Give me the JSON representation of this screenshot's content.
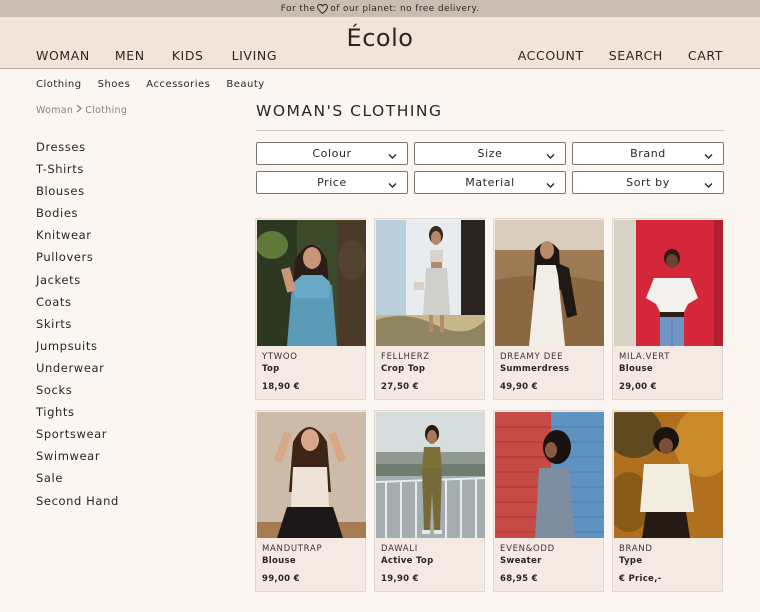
{
  "banner": {
    "prefix": "For the",
    "suffix": "of our planet: no free delivery."
  },
  "header": {
    "logo": "Écolo",
    "nav_left": [
      "WOMAN",
      "MEN",
      "KIDS",
      "LIVING"
    ],
    "nav_right": [
      "ACCOUNT",
      "SEARCH",
      "CART"
    ]
  },
  "subnav": [
    "Clothing",
    "Shoes",
    "Accessories",
    "Beauty"
  ],
  "breadcrumb": [
    "Woman",
    "Clothing"
  ],
  "sidebar": [
    "Dresses",
    "T-Shirts",
    "Blouses",
    "Bodies",
    "Knitwear",
    "Pullovers",
    "Jackets",
    "Coats",
    "Skirts",
    "Jumpsuits",
    "Underwear",
    "Socks",
    "Tights",
    "Sportswear",
    "Swimwear",
    "Sale",
    "Second Hand"
  ],
  "page_title": "WOMAN'S CLOTHING",
  "filters": [
    "Colour",
    "Size",
    "Brand",
    "Price",
    "Material",
    "Sort by"
  ],
  "products": [
    {
      "brand": "YTWOO",
      "type": "Top",
      "price": "18,90 €",
      "photo": "green-garden-blue-top"
    },
    {
      "brand": "FELLHERZ",
      "type": "Crop Top",
      "price": "27,50 €",
      "photo": "sunny-white-wall"
    },
    {
      "brand": "DREAMY DEE",
      "type": "Summerdress",
      "price": "49,90 €",
      "photo": "dry-field-white-dress"
    },
    {
      "brand": "MILA.VERT",
      "type": "Blouse",
      "price": "29,00 €",
      "photo": "red-door"
    },
    {
      "brand": "MANDUTRAP",
      "type": "Blouse",
      "price": "99,00 €",
      "photo": "beige-wall-black-skirt"
    },
    {
      "brand": "DAWALI",
      "type": "Active Top",
      "price": "19,90 €",
      "photo": "balcony-city-view"
    },
    {
      "brand": "EVEN&ODD",
      "type": "Sweater",
      "price": "68,95 €",
      "photo": "red-blue-brick-wall"
    },
    {
      "brand": "BRAND",
      "type": "Type",
      "price": "€ Price,-",
      "photo": "autumn-trees"
    }
  ],
  "colors": {
    "banner_bg": "#c9bdb2",
    "header_bg": "#f3e4da",
    "page_bg": "#fbf6f1",
    "card_bg": "#f5eae3"
  }
}
